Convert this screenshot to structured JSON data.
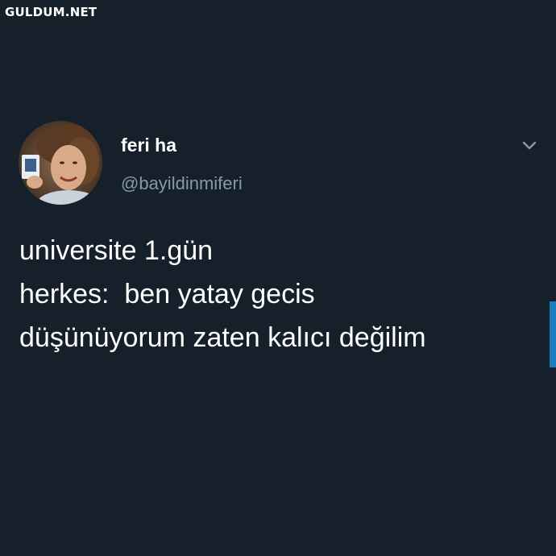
{
  "watermark": "GULDUM.NET",
  "tweet": {
    "author": {
      "display_name": "feri ha",
      "handle": "@bayildinmiferi",
      "avatar_icon": "profile-photo"
    },
    "menu_icon": "chevron-down-icon",
    "lines": [
      "universite 1.gün",
      "herkes:  ben yatay gecis",
      "düşünüyorum zaten kalıcı değilim"
    ]
  },
  "colors": {
    "background": "#15202b",
    "primary_text": "#ffffff",
    "secondary_text": "#8899a6",
    "accent": "#1d9bf0"
  }
}
